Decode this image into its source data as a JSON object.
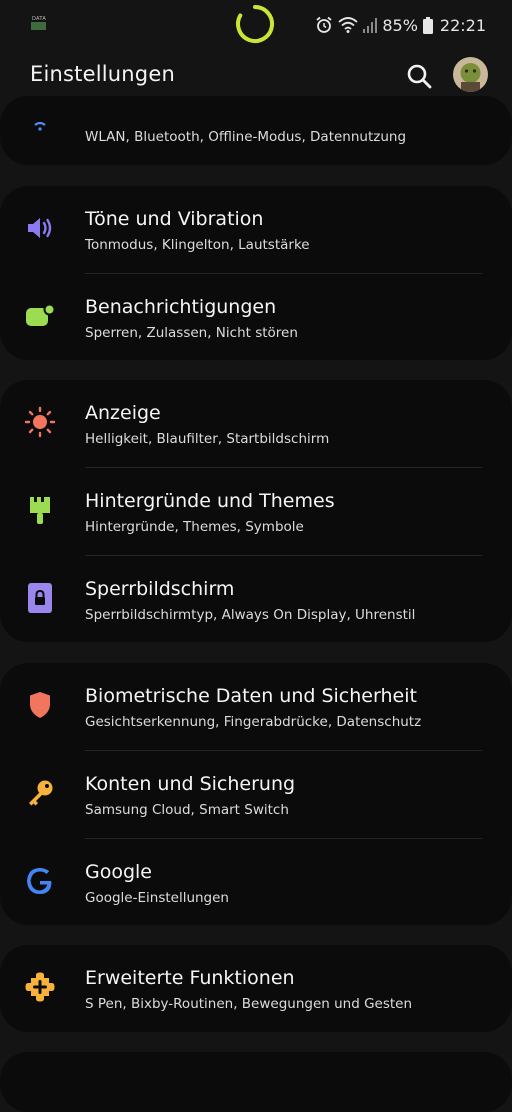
{
  "status_bar": {
    "data_label": "DATA",
    "battery_percent": "85%",
    "time": "22:21",
    "loading_color": "#c8e635"
  },
  "header": {
    "title": "Einstellungen"
  },
  "cards": [
    {
      "items": [
        {
          "title": "",
          "subtitle": "WLAN, Bluetooth, Offline-Modus, Datennutzung",
          "icon": "wifi-icon",
          "color": "#4f8cff"
        }
      ]
    },
    {
      "items": [
        {
          "title": "Töne und Vibration",
          "subtitle": "Tonmodus, Klingelton, Lautstärke",
          "icon": "volume-icon",
          "color": "#8a7cf0"
        },
        {
          "title": "Benachrichtigungen",
          "subtitle": "Sperren, Zulassen, Nicht stören",
          "icon": "notification-icon",
          "color": "#9cdc50"
        }
      ]
    },
    {
      "items": [
        {
          "title": "Anzeige",
          "subtitle": "Helligkeit, Blaufilter, Startbildschirm",
          "icon": "sun-icon",
          "color": "#f2765e"
        },
        {
          "title": "Hintergründe und Themes",
          "subtitle": "Hintergründe, Themes, Symbole",
          "icon": "paintbrush-icon",
          "color": "#9cdc50"
        },
        {
          "title": "Sperrbildschirm",
          "subtitle": "Sperrbildschirmtyp, Always On Display, Uhrenstil",
          "icon": "lock-icon",
          "color": "#9b86ee"
        }
      ]
    },
    {
      "items": [
        {
          "title": "Biometrische Daten und Sicherheit",
          "subtitle": "Gesichtserkennung, Fingerabdrücke, Datenschutz",
          "icon": "shield-icon",
          "color": "#f2765e"
        },
        {
          "title": "Konten und Sicherung",
          "subtitle": "Samsung Cloud, Smart Switch",
          "icon": "key-icon",
          "color": "#f7b23b"
        },
        {
          "title": "Google",
          "subtitle": "Google-Einstellungen",
          "icon": "google-icon",
          "color": "#4285f4"
        }
      ]
    },
    {
      "items": [
        {
          "title": "Erweiterte Funktionen",
          "subtitle": "S Pen, Bixby-Routinen, Bewegungen und Gesten",
          "icon": "puzzle-plus-icon",
          "color": "#f7b23b"
        }
      ]
    }
  ]
}
